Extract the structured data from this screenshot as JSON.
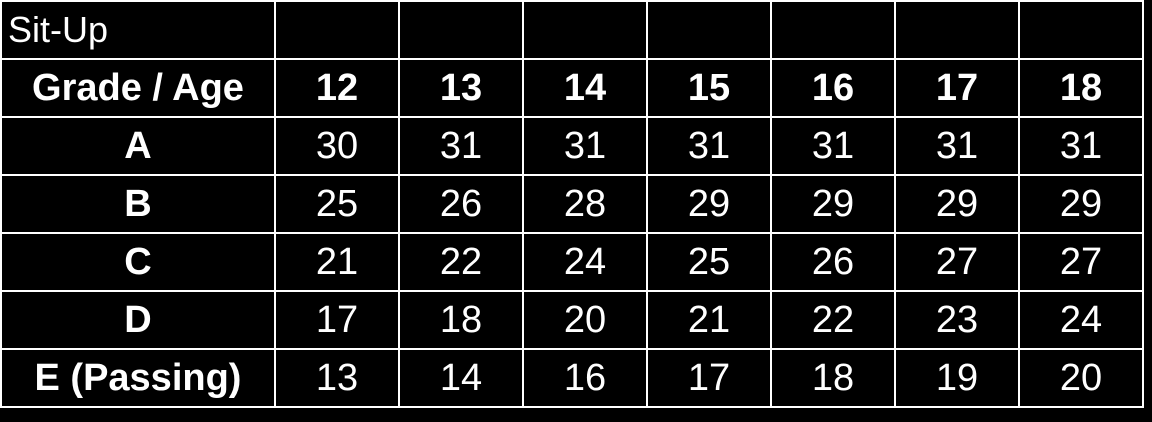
{
  "table": {
    "title": "Sit-Up",
    "header_label": "Grade / Age",
    "ages": [
      "12",
      "13",
      "14",
      "15",
      "16",
      "17",
      "18"
    ],
    "rows": [
      {
        "grade": "A",
        "values": [
          "30",
          "31",
          "31",
          "31",
          "31",
          "31",
          "31"
        ]
      },
      {
        "grade": "B",
        "values": [
          "25",
          "26",
          "28",
          "29",
          "29",
          "29",
          "29"
        ]
      },
      {
        "grade": "C",
        "values": [
          "21",
          "22",
          "24",
          "25",
          "26",
          "27",
          "27"
        ]
      },
      {
        "grade": "D",
        "values": [
          "17",
          "18",
          "20",
          "21",
          "22",
          "23",
          "24"
        ]
      },
      {
        "grade": "E (Passing)",
        "values": [
          "13",
          "14",
          "16",
          "17",
          "18",
          "19",
          "20"
        ]
      }
    ]
  },
  "colors": {
    "background": "#000000",
    "text": "#ffffff",
    "grid": "#ffffff"
  }
}
